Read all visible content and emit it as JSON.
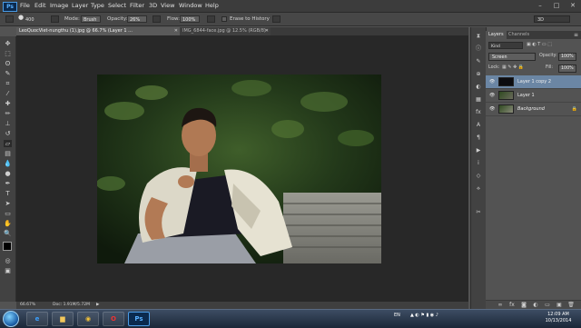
{
  "app": {
    "logo_text": "Ps",
    "menu": [
      "File",
      "Edit",
      "Image",
      "Layer",
      "Type",
      "Select",
      "Filter",
      "3D",
      "View",
      "Window",
      "Help"
    ],
    "window_controls": [
      "–",
      "□",
      "✕"
    ]
  },
  "options_bar": {
    "brush_size": "400",
    "mode_label": "Mode:",
    "mode_value": "Brush",
    "opacity_label": "Opacity:",
    "opacity_value": "26%",
    "flow_label": "Flow:",
    "flow_value": "100%",
    "erase_history_label": "Erase to History",
    "workspace_value": "3D"
  },
  "document_tabs": [
    {
      "title": "LeoQuocViet-nungthu (1).jpg @ 66.7% (Layer 1 ...",
      "active": true
    },
    {
      "title": "IMG_6844-face.jpg @ 12.5% (RGB/8) *",
      "active": false
    }
  ],
  "status_bar": {
    "zoom": "66.67%",
    "doc_size": "Doc: 1.91M/5.72M"
  },
  "layers_panel": {
    "tabs": [
      "Layers",
      "Channels"
    ],
    "kind_label": "Kind",
    "blend_mode": "Screen",
    "opacity_label": "Opacity:",
    "opacity_value": "100%",
    "lock_label": "Lock:",
    "fill_label": "Fill:",
    "fill_value": "100%",
    "layers": [
      {
        "name": "Layer 1 copy 2",
        "selected": true
      },
      {
        "name": "Layer 1",
        "selected": false
      },
      {
        "name": "Background",
        "selected": false
      }
    ]
  },
  "taskbar": {
    "apps": [
      "ie-icon",
      "folder-icon",
      "chrome-icon",
      "opera-icon",
      "photoshop-icon"
    ],
    "language": "EN",
    "time": "12:09 AM",
    "date": "10/13/2014"
  },
  "colors": {
    "accent_selected_layer": "#6b86a4",
    "canvas_bg": "#282828",
    "ui_bg": "#535353"
  }
}
